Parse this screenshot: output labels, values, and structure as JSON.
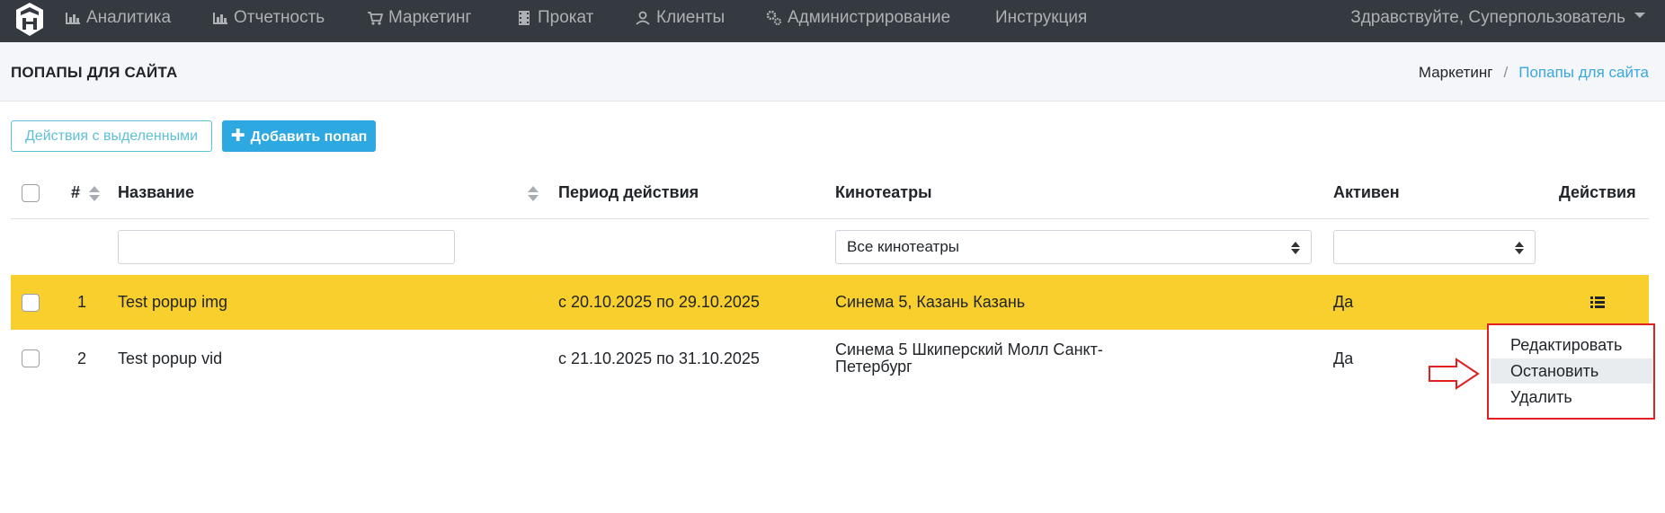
{
  "nav": {
    "items": [
      {
        "label": "Аналитика",
        "icon": "bar-chart-icon"
      },
      {
        "label": "Отчетность",
        "icon": "bar-chart-icon"
      },
      {
        "label": "Маркетинг",
        "icon": "cart-icon"
      },
      {
        "label": "Прокат",
        "icon": "film-icon"
      },
      {
        "label": "Клиенты",
        "icon": "user-icon"
      },
      {
        "label": "Администрирование",
        "icon": "cogs-icon"
      },
      {
        "label": "Инструкция",
        "icon": ""
      }
    ],
    "user_greeting": "Здравствуйте, Суперпользователь"
  },
  "header": {
    "title": "ПОПАПЫ ДЛЯ САЙТА",
    "breadcrumb": [
      "Маркетинг",
      "/",
      "Попапы для сайта"
    ]
  },
  "toolbar": {
    "bulk_actions_label": "Действия с выделенными",
    "add_label": "Добавить попап",
    "add_icon": "plus-icon"
  },
  "table": {
    "columns": [
      "#",
      "Название",
      "Период действия",
      "Кинотеатры",
      "Активен",
      "Действия"
    ],
    "filters": {
      "name_value": "",
      "cinema_selected": "Все кинотеатры",
      "active_selected": ""
    },
    "rows": [
      {
        "id": "1",
        "name": "Test popup img",
        "period": "с 20.10.2025 по 29.10.2025",
        "cinemas_line1": "Синема 5, Казань Казань",
        "cinemas_line2": "",
        "active": "Да"
      },
      {
        "id": "2",
        "name": "Test popup vid",
        "period": "с 21.10.2025 по 31.10.2025",
        "cinemas_line1": "Синема 5 Шкиперский Молл Санкт-",
        "cinemas_line2": "Петербург",
        "active": "Да"
      }
    ]
  },
  "row_menu": {
    "items": [
      "Редактировать",
      "Остановить",
      "Удалить"
    ],
    "hovered": "Остановить"
  },
  "colors": {
    "nav_bg": "#343a40",
    "highlight_row": "#f8cf2c",
    "primary": "#2ea8e0",
    "info_outline": "#5dc0d9",
    "annotation_red": "#e02020"
  }
}
